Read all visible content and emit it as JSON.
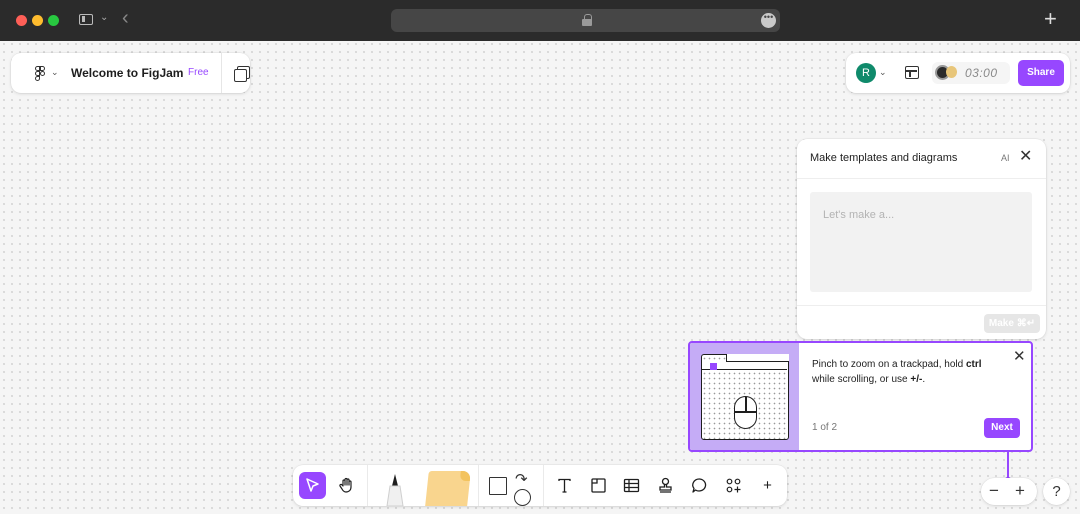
{
  "file": {
    "title": "Welcome to FigJam",
    "plan_badge": "Free"
  },
  "header": {
    "avatar_initial": "R",
    "timer": "03:00",
    "share_label": "Share"
  },
  "templates": {
    "title": "Make templates and diagrams",
    "ai_label": "AI",
    "placeholder": "Let's make a...",
    "make_label": "Make ⌘↵"
  },
  "tip": {
    "text_prefix": "Pinch to zoom on a trackpad, hold ",
    "ctrl": "ctrl",
    "text_middle": " while scrolling, or use ",
    "keys": "+/-",
    "text_suffix": ".",
    "counter": "1 of 2",
    "next_label": "Next"
  },
  "zoom": {
    "out": "−",
    "in": "+"
  },
  "help_label": "?",
  "colors": {
    "accent": "#9747ff",
    "avatar": "#0f8a6b",
    "sticky": "#f9d58e"
  },
  "toolbar": {
    "tools": [
      "select-icon",
      "hand-icon",
      "marker-icon",
      "sticky-note-icon",
      "shape-icon",
      "connector-icon",
      "text-icon",
      "section-icon",
      "table-icon",
      "stamp-icon",
      "comment-icon",
      "more-tools-icon",
      "add-icon"
    ],
    "add_label": "+"
  }
}
